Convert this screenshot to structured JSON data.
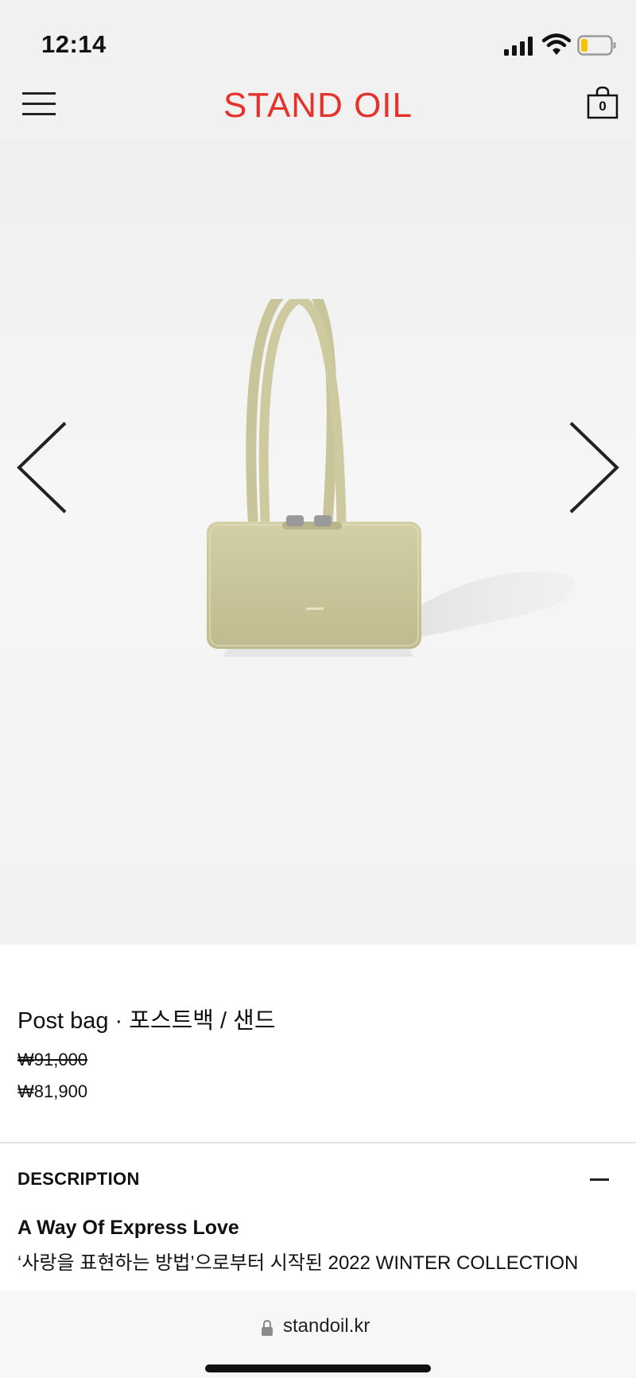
{
  "status_bar": {
    "time": "12:14",
    "icons": [
      "signal-icon",
      "wifi-icon",
      "battery-icon"
    ]
  },
  "header": {
    "brand": "STAND OIL",
    "cart_count": "0",
    "icons": [
      "menu-icon",
      "shopping-bag-icon"
    ]
  },
  "gallery": {
    "image_subject": "product-photo-bag",
    "icons": [
      "chevron-left-icon",
      "chevron-right-icon"
    ]
  },
  "product": {
    "title": "Post bag · 포스트백 / 샌드",
    "original_price": "₩91,000",
    "sale_price": "₩81,900"
  },
  "description": {
    "header": "DESCRIPTION",
    "title": "A Way Of Express Love",
    "text": "‘사랑을 표현하는 방법’으로부터 시작된 2022 WINTER COLLECTION"
  },
  "browser": {
    "url": "standoil.kr"
  },
  "colors": {
    "brand": "#e5322b",
    "bag": "#c9c69a",
    "background": "#f1f1f1"
  }
}
